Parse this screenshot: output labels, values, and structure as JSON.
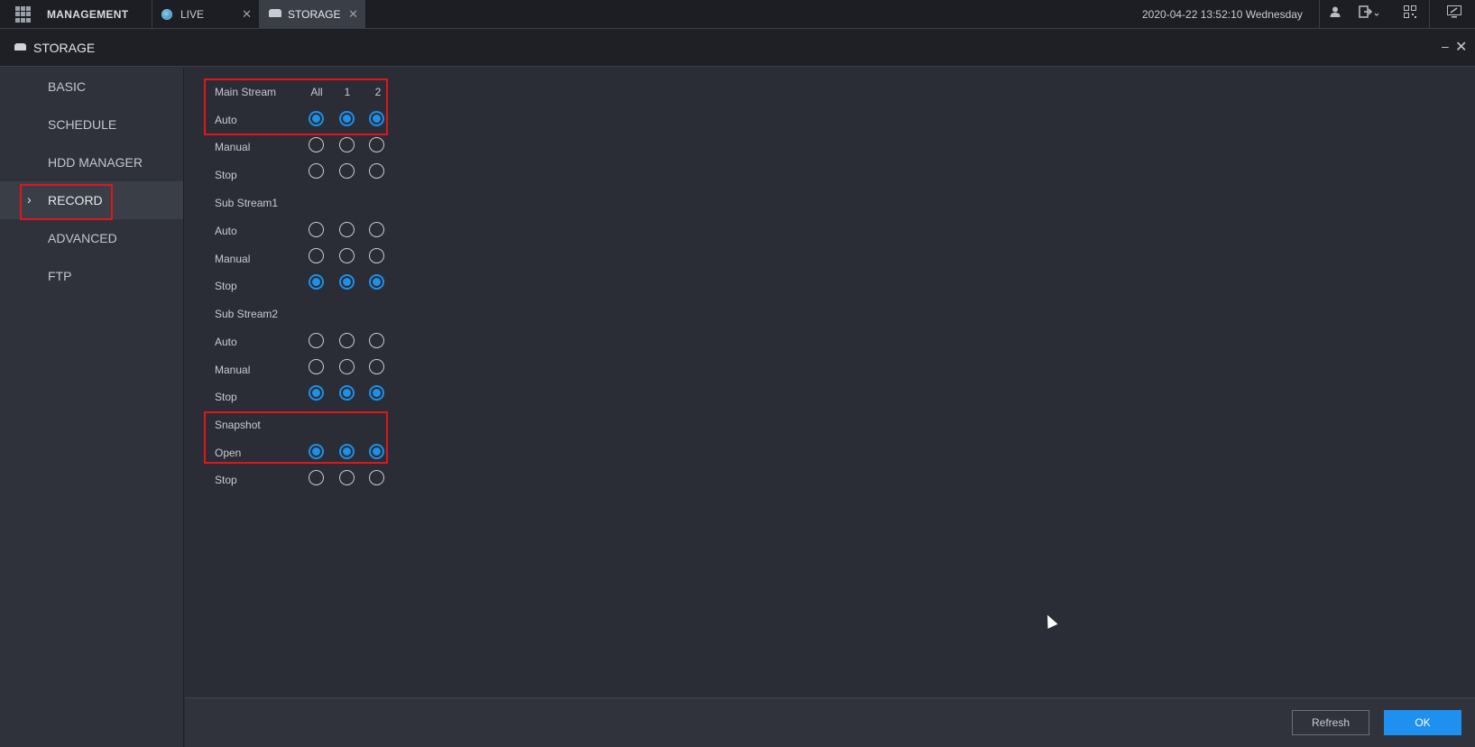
{
  "topbar": {
    "app_label": "MANAGEMENT",
    "tabs": [
      {
        "label": "LIVE",
        "icon": "globe-icon",
        "close": "✕"
      },
      {
        "label": "STORAGE",
        "icon": "hdd-icon",
        "close": "✕"
      }
    ],
    "datetime": "2020-04-22 13:52:10 Wednesday",
    "icons": [
      "user-icon",
      "logout-icon",
      "qr-code-icon",
      "display-settings-icon"
    ]
  },
  "window": {
    "title": "STORAGE",
    "minimize": "–",
    "close": "✕"
  },
  "sidebar": {
    "items": [
      {
        "label": "BASIC",
        "active": false
      },
      {
        "label": "SCHEDULE",
        "active": false
      },
      {
        "label": "HDD MANAGER",
        "active": false
      },
      {
        "label": "RECORD",
        "active": true
      },
      {
        "label": "ADVANCED",
        "active": false
      },
      {
        "label": "FTP",
        "active": false
      }
    ],
    "active_marker": "›"
  },
  "record": {
    "columns": [
      "All",
      "1",
      "2"
    ],
    "groups": [
      {
        "name": "Main Stream",
        "rows": [
          {
            "label": "Auto",
            "values": [
              true,
              true,
              true
            ]
          },
          {
            "label": "Manual",
            "values": [
              false,
              false,
              false
            ]
          },
          {
            "label": "Stop",
            "values": [
              false,
              false,
              false
            ]
          }
        ]
      },
      {
        "name": "Sub Stream1",
        "rows": [
          {
            "label": "Auto",
            "values": [
              false,
              false,
              false
            ]
          },
          {
            "label": "Manual",
            "values": [
              false,
              false,
              false
            ]
          },
          {
            "label": "Stop",
            "values": [
              true,
              true,
              true
            ]
          }
        ]
      },
      {
        "name": "Sub Stream2",
        "rows": [
          {
            "label": "Auto",
            "values": [
              false,
              false,
              false
            ]
          },
          {
            "label": "Manual",
            "values": [
              false,
              false,
              false
            ]
          },
          {
            "label": "Stop",
            "values": [
              true,
              true,
              true
            ]
          }
        ]
      },
      {
        "name": "Snapshot",
        "rows": [
          {
            "label": "Open",
            "values": [
              true,
              true,
              true
            ]
          },
          {
            "label": "Stop",
            "values": [
              false,
              false,
              false
            ]
          }
        ]
      }
    ]
  },
  "footer": {
    "refresh_label": "Refresh",
    "ok_label": "OK"
  },
  "colors": {
    "accent": "#1e90f0",
    "highlight": "#e0161b",
    "background": "#2a2d35"
  }
}
